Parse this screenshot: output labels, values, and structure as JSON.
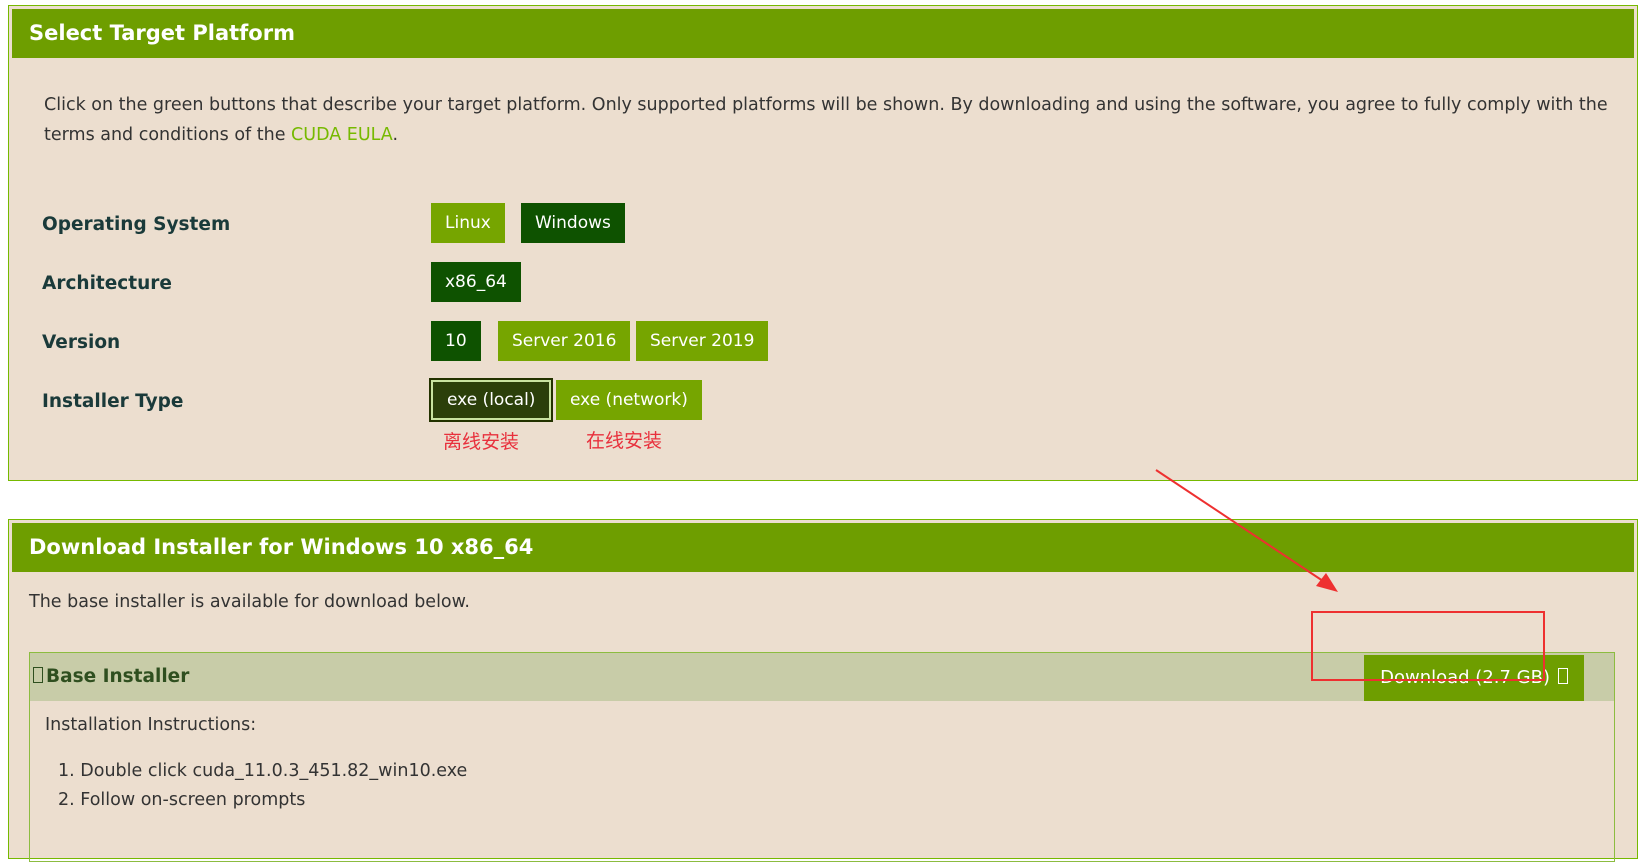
{
  "platform": {
    "header": "Select Target Platform",
    "intro_text": "Click on the green buttons that describe your target platform. Only supported platforms will be shown. By downloading and using the software, you agree to fully comply with the terms and conditions of the ",
    "eula_link": "CUDA EULA",
    "intro_end": ".",
    "rows": {
      "os": {
        "label": "Operating System",
        "options": [
          "Linux",
          "Windows"
        ],
        "selected": "Windows"
      },
      "arch": {
        "label": "Architecture",
        "options": [
          "x86_64"
        ],
        "selected": "x86_64"
      },
      "version": {
        "label": "Version",
        "options": [
          "10",
          "Server 2016",
          "Server 2019"
        ],
        "selected": "10"
      },
      "installer": {
        "label": "Installer Type",
        "options": [
          "exe (local)",
          "exe (network)"
        ],
        "selected": "exe (local)"
      }
    },
    "annotations": {
      "local": "离线安装",
      "network": "在线安装"
    }
  },
  "download": {
    "header": "Download Installer for Windows 10 x86_64",
    "subtext": "The base installer is available for download below.",
    "section_title": "Base Installer",
    "button_label": "Download (2.7 GB)",
    "instructions_title": "Installation Instructions:",
    "steps": [
      "1. Double click cuda_11.0.3_451.82_win10.exe",
      "2. Follow on-screen prompts"
    ]
  },
  "colors": {
    "header_green": "#6e9e00",
    "button_green": "#76a500",
    "selected_green": "#0e5200",
    "annotation_red": "#e8303c"
  }
}
